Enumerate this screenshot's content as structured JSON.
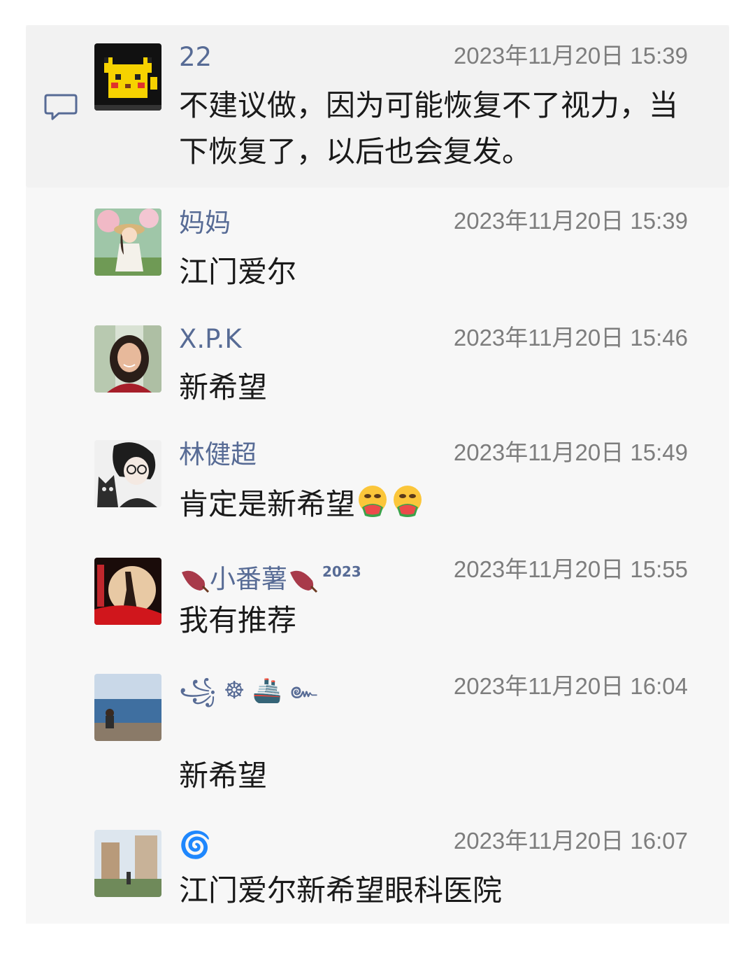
{
  "comments": [
    {
      "name": "22",
      "time": "2023年11月20日 15:39",
      "text": "不建议做，因为可能恢复不了视力，当下恢复了，以后也会复发。",
      "avatar": "pikachu-avatar"
    },
    {
      "name": "妈妈",
      "time": "2023年11月20日 15:39",
      "text": "江门爱尔",
      "avatar": "anime-girl-avatar"
    },
    {
      "name": "X.P.K",
      "time": "2023年11月20日 15:46",
      "text": "新希望",
      "avatar": "woman-photo-avatar"
    },
    {
      "name": "林健超",
      "time": "2023年11月20日 15:49",
      "text": "肯定是新希望",
      "avatar": "anime-boy-cat-avatar"
    },
    {
      "name": "小番薯",
      "name_badge": "2023",
      "time": "2023年11月20日 15:55",
      "text": "我有推荐",
      "avatar": "moon-silhouette-avatar"
    },
    {
      "name": "꧁ ☸ 🚢 ๛",
      "time": "2023年11月20日 16:04",
      "text": "新希望",
      "avatar": "seaside-photo-avatar"
    },
    {
      "name": "🌀",
      "time": "2023年11月20日 16:07",
      "text": "江门爱尔新希望眼科医院",
      "avatar": "building-photo-avatar"
    }
  ],
  "icons": {
    "comment": "comment-icon",
    "emoji": "drooling-face-watermelon-emoji",
    "sweet_potato": "sweet-potato-emoji"
  },
  "colors": {
    "name": "#576b95",
    "time": "#7d7d7d",
    "text": "#1a1a1a",
    "panel": "#f7f7f7"
  }
}
